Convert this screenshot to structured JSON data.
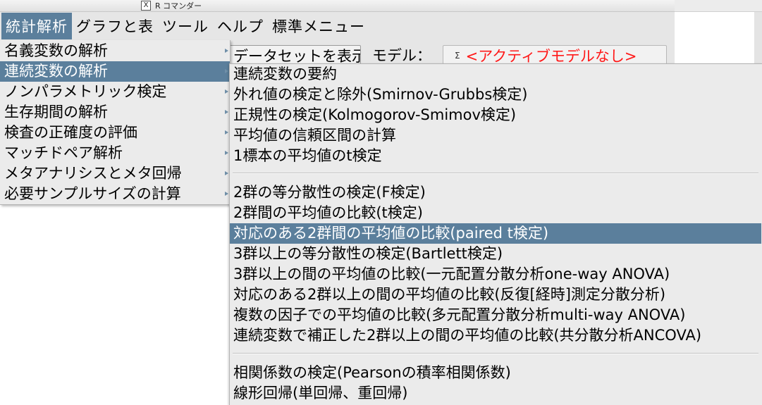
{
  "window": {
    "title": "R コマンダー"
  },
  "menubar": {
    "items": [
      {
        "label": "統計解析"
      },
      {
        "label": "グラフと表"
      },
      {
        "label": "ツール"
      },
      {
        "label": "ヘルプ"
      },
      {
        "label": "標準メニュー"
      }
    ]
  },
  "toolbar": {
    "dataset_button": "データセットを表示",
    "model_label": "モデル：",
    "model_icon": "sigma-icon",
    "model_value": "<アクティブモデルなし>"
  },
  "stats_menu": {
    "items": [
      {
        "label": "名義変数の解析"
      },
      {
        "label": "連続変数の解析"
      },
      {
        "label": "ノンパラメトリック検定"
      },
      {
        "label": "生存期間の解析"
      },
      {
        "label": "検査の正確度の評価"
      },
      {
        "label": "マッチドペア解析"
      },
      {
        "label": "メタアナリシスとメタ回帰"
      },
      {
        "label": "必要サンプルサイズの計算"
      }
    ]
  },
  "continuous_submenu": {
    "items": [
      {
        "label": "連続変数の要約"
      },
      {
        "label": "外れ値の検定と除外(Smirnov-Grubbs検定)"
      },
      {
        "label": "正規性の検定(Kolmogorov-Smimov検定)"
      },
      {
        "label": "平均値の信頼区間の計算"
      },
      {
        "label": "1標本の平均値のt検定"
      },
      {
        "label": "2群の等分散性の検定(F検定)"
      },
      {
        "label": "2群間の平均値の比較(t検定)"
      },
      {
        "label": "対応のある2群間の平均値の比較(paired t検定)"
      },
      {
        "label": "3群以上の等分散性の検定(Bartlett検定)"
      },
      {
        "label": "3群以上の間の平均値の比較(一元配置分散分析one-way ANOVA)"
      },
      {
        "label": "対応のある2群以上の間の平均値の比較(反復[経時]測定分散分析)"
      },
      {
        "label": "複数の因子での平均値の比較(多元配置分散分析multi-way ANOVA)"
      },
      {
        "label": "連続変数で補正した2群以上の間の平均値の比較(共分散分析ANCOVA)"
      },
      {
        "label": "相関係数の検定(Pearsonの積率相関係数)"
      },
      {
        "label": "線形回帰(単回帰、重回帰)"
      }
    ]
  },
  "colors": {
    "highlight": "#5b7f9c",
    "menu_bg": "#ebebeb",
    "model_value": "#ff1a1a"
  }
}
